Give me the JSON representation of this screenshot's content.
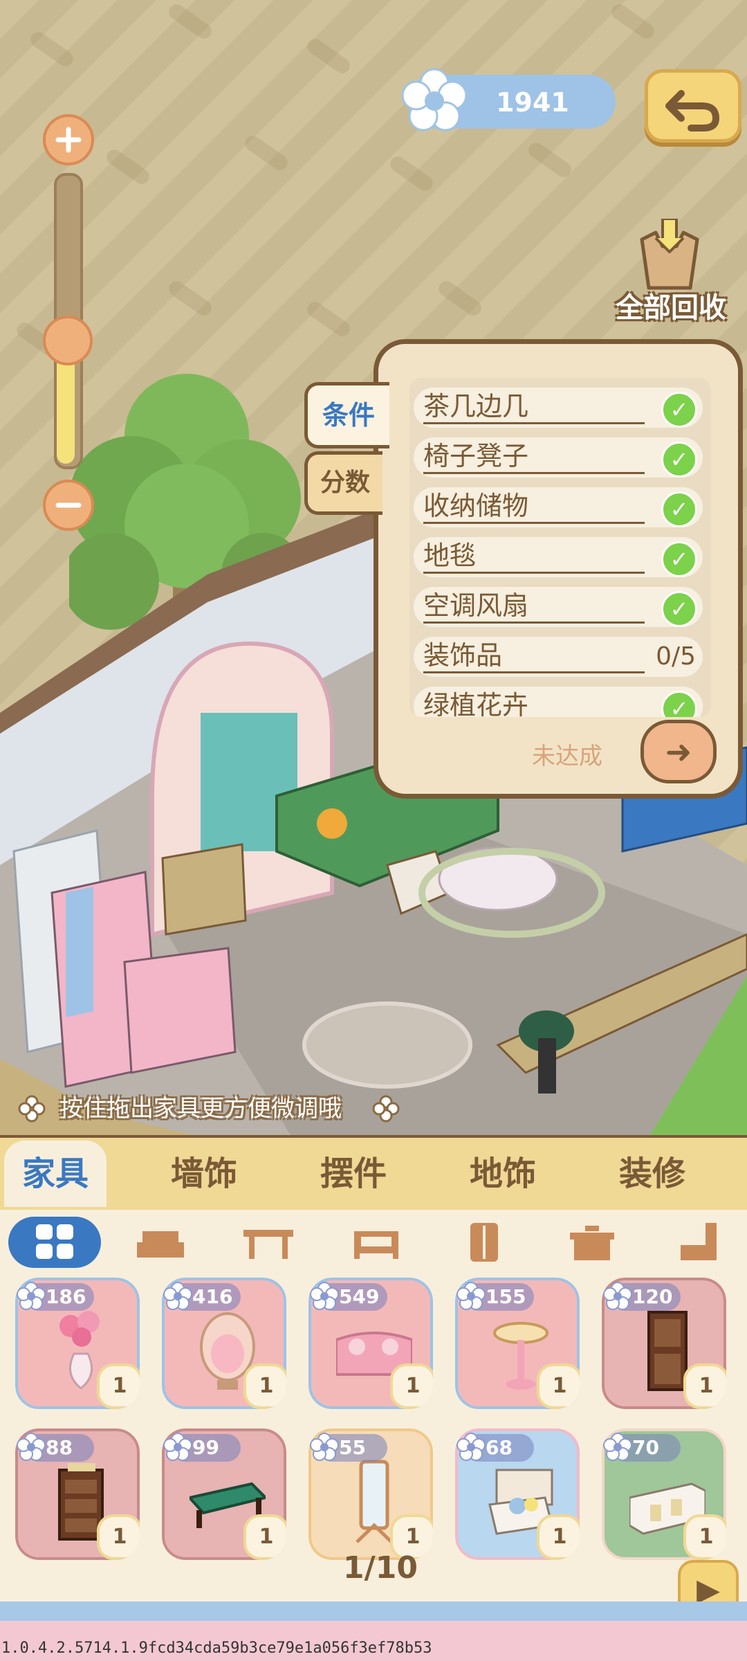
{
  "currency": {
    "value": "1941",
    "icon": "flower-coin-icon"
  },
  "recycle": {
    "label": "全部回收",
    "icon": "recycle-box-icon"
  },
  "conditions_panel": {
    "tabs": {
      "conditions": "条件",
      "score": "分数"
    },
    "items": [
      {
        "label": "茶几边几",
        "done": true
      },
      {
        "label": "椅子凳子",
        "done": true
      },
      {
        "label": "收纳储物",
        "done": true
      },
      {
        "label": "地毯",
        "done": true
      },
      {
        "label": "空调风扇",
        "done": true
      },
      {
        "label": "装饰品",
        "done": false,
        "progress": "0/5"
      },
      {
        "label": "绿植花卉",
        "done": true
      }
    ],
    "status": "未达成"
  },
  "hint": "按住拖出家具更方便微调哦",
  "main_tabs": [
    "家具",
    "墙饰",
    "摆件",
    "地饰",
    "装修"
  ],
  "categories": [
    "grid-icon",
    "sofa-icon",
    "table-icon",
    "bed-icon",
    "wardrobe-icon",
    "cabinet-icon",
    "chair-icon"
  ],
  "items": [
    {
      "price": "186",
      "qty": "1",
      "name": "flower-vase",
      "bg": "#f3b9b9"
    },
    {
      "price": "416",
      "qty": "1",
      "name": "egg-chair",
      "bg": "#f3b9b9"
    },
    {
      "price": "549",
      "qty": "1",
      "name": "pink-sofa",
      "bg": "#f3b9b9"
    },
    {
      "price": "155",
      "qty": "1",
      "name": "side-table",
      "bg": "#f3b9b9"
    },
    {
      "price": "120",
      "qty": "1",
      "name": "wood-cabinet",
      "bg": "#e7b3b3"
    },
    {
      "price": "88",
      "qty": "1",
      "name": "wood-dresser",
      "bg": "#e7b3b3"
    },
    {
      "price": "99",
      "qty": "1",
      "name": "green-bench",
      "bg": "#e7b3b3"
    },
    {
      "price": "55",
      "qty": "1",
      "name": "standing-mirror",
      "bg": "#f6dcb8"
    },
    {
      "price": "68",
      "qty": "1",
      "name": "bed-bookshelf",
      "bg": "#b9d7ee"
    },
    {
      "price": "70",
      "qty": "1",
      "name": "white-sideboard",
      "bg": "#9fc79a"
    }
  ],
  "pagination": "1/10",
  "version": "1.0.4.2.5714.1.9fcd34cda59b3ce79e1a056f3ef78b53",
  "colors": {
    "accent_blue": "#3a78c2",
    "brown": "#7a5a36",
    "check_green": "#7cd24a",
    "tab_yellow": "#f0d895"
  }
}
